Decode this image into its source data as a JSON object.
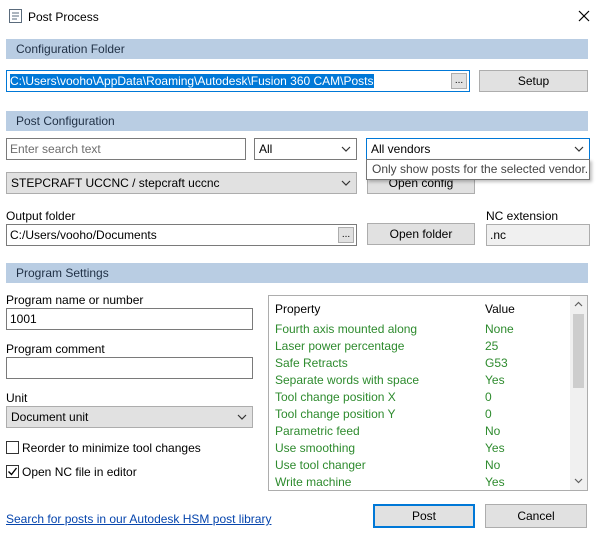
{
  "window": {
    "title": "Post Process"
  },
  "config_folder": {
    "header": "Configuration Folder",
    "path": "C:\\Users\\vooho\\AppData\\Roaming\\Autodesk\\Fusion 360 CAM\\Posts",
    "browse_label": "...",
    "setup_label": "Setup"
  },
  "post_config": {
    "header": "Post Configuration",
    "search_placeholder": "Enter search text",
    "filter_value": "All",
    "vendor_value": "All vendors",
    "vendor_tooltip": "Only show posts for the selected vendor.",
    "post_value": "STEPCRAFT UCCNC / stepcraft uccnc",
    "open_config_label": "Open config",
    "output_folder_label": "Output folder",
    "output_folder_value": "C:/Users/vooho/Documents",
    "output_browse_label": "...",
    "open_folder_label": "Open folder",
    "nc_extension_label": "NC extension",
    "nc_extension_value": ".nc"
  },
  "program_settings": {
    "header": "Program Settings",
    "name_label": "Program name or number",
    "name_value": "1001",
    "comment_label": "Program comment",
    "comment_value": "",
    "unit_label": "Unit",
    "unit_value": "Document unit",
    "reorder_label": "Reorder to minimize tool changes",
    "reorder_checked": false,
    "open_nc_label": "Open NC file in editor",
    "open_nc_checked": true
  },
  "properties": {
    "col_property": "Property",
    "col_value": "Value",
    "rows": [
      {
        "property": "Fourth axis mounted along",
        "value": "None"
      },
      {
        "property": "Laser power percentage",
        "value": "25"
      },
      {
        "property": "Safe Retracts",
        "value": "G53"
      },
      {
        "property": "Separate words with space",
        "value": "Yes"
      },
      {
        "property": "Tool change position X",
        "value": "0"
      },
      {
        "property": "Tool change position Y",
        "value": "0"
      },
      {
        "property": "Parametric feed",
        "value": "No"
      },
      {
        "property": "Use smoothing",
        "value": "Yes"
      },
      {
        "property": "Use tool changer",
        "value": "No"
      },
      {
        "property": "Write machine",
        "value": "Yes"
      }
    ]
  },
  "footer": {
    "library_link": "Search for posts in our Autodesk HSM post library",
    "post_label": "Post",
    "cancel_label": "Cancel"
  }
}
